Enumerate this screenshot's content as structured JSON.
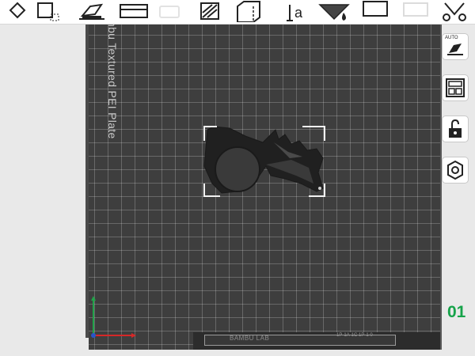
{
  "plate": {
    "label": "nbu Textured PEI Plate",
    "footer_text": "BAMBU LAB",
    "footer_small": "1P·1A·1C 1P·1 0"
  },
  "plate_number": "01",
  "toolbar": {
    "items": [
      "diamond-icon",
      "select-rect-icon",
      "place-on-face-icon",
      "cut-icon",
      "blank-icon",
      "support-paint-icon",
      "seam-paint-icon",
      "text-icon",
      "color-paint-icon",
      "measure-icon",
      "assembly-icon",
      "split-icon"
    ],
    "text_tool_label": "a"
  },
  "right_buttons": [
    "auto-orient-icon",
    "arrange-icon",
    "lock-icon",
    "nut-icon"
  ],
  "auto_label": "AUTO",
  "colors": {
    "plate": "#3e3e3e",
    "grid": "#6e6e6e",
    "accent_green": "#16a34a",
    "axis_red": "#d62828",
    "axis_green": "#22a34a"
  }
}
